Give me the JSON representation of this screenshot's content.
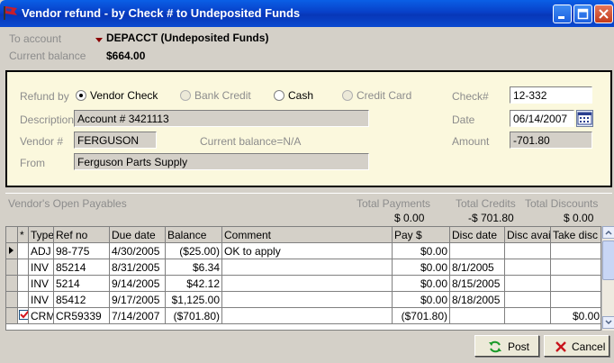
{
  "window": {
    "title": "Vendor refund  - by Check # to Undeposited Funds"
  },
  "account": {
    "to_account_label": "To account",
    "to_account_value": "DEPACCT (Undeposited Funds)",
    "current_balance_label": "Current balance",
    "current_balance_value": "$664.00"
  },
  "refund": {
    "refund_by_label": "Refund by",
    "options": [
      {
        "label": "Vendor Check",
        "selected": true,
        "enabled": true
      },
      {
        "label": "Bank Credit",
        "selected": false,
        "enabled": false
      },
      {
        "label": "Cash",
        "selected": false,
        "enabled": true
      },
      {
        "label": "Credit Card",
        "selected": false,
        "enabled": false
      }
    ],
    "description_label": "Description",
    "description_value": "Account # 3421113",
    "vendor_label": "Vendor #",
    "vendor_value": "FERGUSON",
    "vendor_balance_text": "Current balance=N/A",
    "from_label": "From",
    "from_value": "Ferguson Parts Supply",
    "check_label": "Check#",
    "check_value": "12-332",
    "date_label": "Date",
    "date_value": "06/14/2007",
    "amount_label": "Amount",
    "amount_value": "-701.80"
  },
  "payables": {
    "section_label": "Vendor's Open Payables",
    "total_payments_label": "Total Payments",
    "total_payments_value": "$ 0.00",
    "total_credits_label": "Total Credits",
    "total_credits_value": "-$ 701.80",
    "total_discounts_label": "Total Discounts",
    "total_discounts_value": "$ 0.00",
    "columns": [
      "*",
      "Type",
      "Ref no",
      "Due date",
      "Balance",
      "Comment",
      "Pay $",
      "Disc date",
      "Disc avail",
      "Take disc"
    ],
    "rows": [
      {
        "type": "ADJ",
        "ref": "98-775",
        "due": "4/30/2005",
        "balance": "($25.00)",
        "comment": "OK to apply",
        "pay": "$0.00",
        "disc_date": "",
        "disc_avail": "",
        "take_disc": "",
        "checked": false,
        "current": true
      },
      {
        "type": "INV",
        "ref": "85214",
        "due": "8/31/2005",
        "balance": "$6.34",
        "comment": "",
        "pay": "$0.00",
        "disc_date": "8/1/2005",
        "disc_avail": "",
        "take_disc": "",
        "checked": false,
        "current": false
      },
      {
        "type": "INV",
        "ref": "5214",
        "due": "9/14/2005",
        "balance": "$42.12",
        "comment": "",
        "pay": "$0.00",
        "disc_date": "8/15/2005",
        "disc_avail": "",
        "take_disc": "",
        "checked": false,
        "current": false
      },
      {
        "type": "INV",
        "ref": "85412",
        "due": "9/17/2005",
        "balance": "$1,125.00",
        "comment": "",
        "pay": "$0.00",
        "disc_date": "8/18/2005",
        "disc_avail": "",
        "take_disc": "",
        "checked": false,
        "current": false
      },
      {
        "type": "CRM",
        "ref": "CR59339",
        "due": "7/14/2007",
        "balance": "($701.80)",
        "comment": "",
        "pay": "($701.80)",
        "disc_date": "",
        "disc_avail": "",
        "take_disc": "$0.00",
        "checked": true,
        "current": false
      }
    ]
  },
  "buttons": {
    "post_label": "Post",
    "cancel_label": "Cancel"
  },
  "colors": {
    "title_bar": "#0840c8",
    "panel_bg": "#fbf8dd",
    "grid_bg": "#d4d0c8"
  }
}
